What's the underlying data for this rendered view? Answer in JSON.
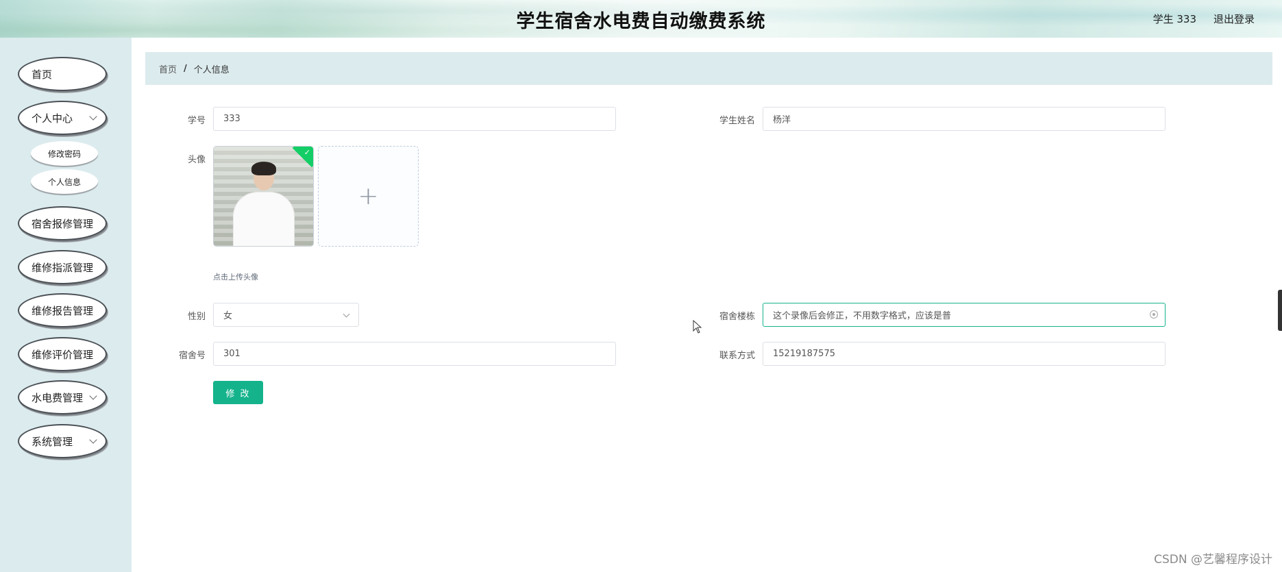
{
  "header": {
    "title": "学生宿舍水电费自动缴费系统",
    "user": "学生 333",
    "logout": "退出登录"
  },
  "sidebar": {
    "items": [
      {
        "label": "首页"
      },
      {
        "label": "个人中心",
        "expanded": true
      },
      {
        "label": "宿舍报修管理"
      },
      {
        "label": "维修指派管理"
      },
      {
        "label": "维修报告管理"
      },
      {
        "label": "维修评价管理"
      },
      {
        "label": "水电费管理"
      },
      {
        "label": "系统管理"
      }
    ],
    "sub_items": [
      {
        "label": "修改密码"
      },
      {
        "label": "个人信息"
      }
    ]
  },
  "breadcrumb": {
    "home": "首页",
    "separator": "/",
    "current": "个人信息"
  },
  "form": {
    "student_id_label": "学号",
    "student_id_value": "333",
    "student_name_label": "学生姓名",
    "student_name_value": "杨洋",
    "avatar_label": "头像",
    "avatar_hint": "点击上传头像",
    "gender_label": "性别",
    "gender_value": "女",
    "building_label": "宿舍楼栋",
    "building_value": "这个录像后会修正，不用数字格式，应该是普",
    "room_label": "宿舍号",
    "room_value": "301",
    "contact_label": "联系方式",
    "contact_value": "15219187575",
    "submit_label": "修 改"
  },
  "watermark": "CSDN @艺馨程序设计",
  "colors": {
    "primary": "#14b38c",
    "sidebar_bg": "#dcebee",
    "breadcrumb_bg": "#dcebee",
    "success": "#13ce66"
  }
}
